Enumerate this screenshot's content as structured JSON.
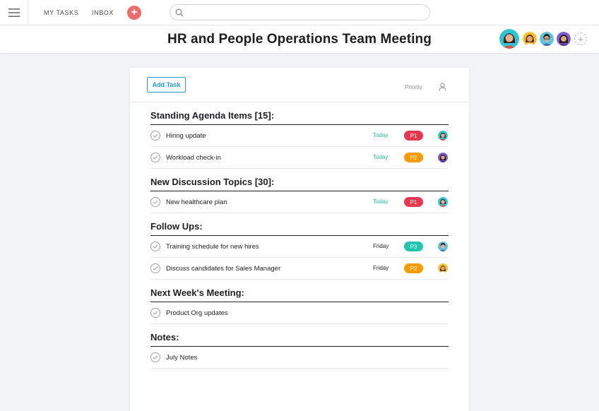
{
  "nav": {
    "my_tasks": "MY TASKS",
    "inbox": "INBOX"
  },
  "search": {
    "placeholder": ""
  },
  "header": {
    "title": "HR and People Operations Team Meeting"
  },
  "toolbar": {
    "add_task": "Add Task",
    "priority": "Priority"
  },
  "colors": {
    "accent": "#1f9bd1",
    "add_button": "#f06a6a",
    "today": "#25b89a",
    "p1": "#e8384f",
    "p2": "#fd9a00",
    "p3": "#20c6b0"
  },
  "sections": [
    {
      "title": "Standing Agenda Items [15]:"
    },
    {
      "title": "New Discussion Topics [30]:"
    },
    {
      "title": "Follow Ups:"
    },
    {
      "title": "Next Week's Meeting:"
    },
    {
      "title": "Notes:"
    }
  ],
  "tasks": [
    {
      "name": "Hiring update",
      "due": "Today",
      "priority": "P1",
      "assignee_icon": "avatar-teal"
    },
    {
      "name": "Workload check-in",
      "due": "Today",
      "priority": "P2",
      "assignee_icon": "avatar-purple"
    },
    {
      "name": "New healthcare plan",
      "due": "Today",
      "priority": "P1",
      "assignee_icon": "avatar-teal"
    },
    {
      "name": "Training schedule for new hires",
      "due": "Friday",
      "priority": "P3",
      "assignee_icon": "avatar-blue"
    },
    {
      "name": "Discuss candidates for Sales Manager",
      "due": "Friday",
      "priority": "P2",
      "assignee_icon": "avatar-yellow"
    },
    {
      "name": "Product Org updates"
    },
    {
      "name": "July Notes"
    }
  ]
}
